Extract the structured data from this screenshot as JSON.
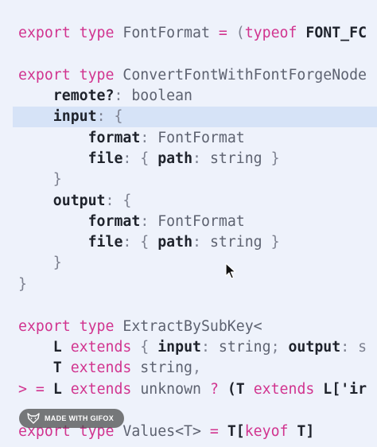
{
  "editor": {
    "highlighted_line_index": 3,
    "lines": [
      [
        {
          "t": "export type ",
          "c": "kw"
        },
        {
          "t": "FontFormat",
          "c": "tn"
        },
        {
          "t": " = ",
          "c": "kw"
        },
        {
          "t": "(",
          "c": "pn"
        },
        {
          "t": "typeof",
          "c": "kw"
        },
        {
          "t": " FONT_FC",
          "c": "id"
        }
      ],
      [
        {
          "t": "export type ",
          "c": "kw"
        },
        {
          "t": "ConvertFontWithFontForgeNode",
          "c": "tn"
        }
      ],
      [
        {
          "t": "    remote?",
          "c": "id"
        },
        {
          "t": ": ",
          "c": "pn"
        },
        {
          "t": "boolean",
          "c": "tp"
        }
      ],
      [
        {
          "t": "    input",
          "c": "id"
        },
        {
          "t": ": {",
          "c": "pn"
        }
      ],
      [
        {
          "t": "        format",
          "c": "id"
        },
        {
          "t": ": ",
          "c": "pn"
        },
        {
          "t": "FontFormat",
          "c": "tp"
        }
      ],
      [
        {
          "t": "        file",
          "c": "id"
        },
        {
          "t": ": { ",
          "c": "pn"
        },
        {
          "t": "path",
          "c": "id"
        },
        {
          "t": ": ",
          "c": "pn"
        },
        {
          "t": "string",
          "c": "tp"
        },
        {
          "t": " }",
          "c": "pn"
        }
      ],
      [
        {
          "t": "    }",
          "c": "pn"
        }
      ],
      [
        {
          "t": "    output",
          "c": "id"
        },
        {
          "t": ": {",
          "c": "pn"
        }
      ],
      [
        {
          "t": "        format",
          "c": "id"
        },
        {
          "t": ": ",
          "c": "pn"
        },
        {
          "t": "FontFormat",
          "c": "tp"
        }
      ],
      [
        {
          "t": "        file",
          "c": "id"
        },
        {
          "t": ": { ",
          "c": "pn"
        },
        {
          "t": "path",
          "c": "id"
        },
        {
          "t": ": ",
          "c": "pn"
        },
        {
          "t": "string",
          "c": "tp"
        },
        {
          "t": " }",
          "c": "pn"
        }
      ],
      [
        {
          "t": "    }",
          "c": "pn"
        }
      ],
      [
        {
          "t": "}",
          "c": "pn"
        }
      ],
      [
        {
          "t": "export type ",
          "c": "kw"
        },
        {
          "t": "ExtractBySubKey<",
          "c": "tn"
        }
      ],
      [
        {
          "t": "    L ",
          "c": "id"
        },
        {
          "t": "extends",
          "c": "kw"
        },
        {
          "t": " { ",
          "c": "pn"
        },
        {
          "t": "input",
          "c": "id"
        },
        {
          "t": ": ",
          "c": "pn"
        },
        {
          "t": "string",
          "c": "tp"
        },
        {
          "t": "; ",
          "c": "pn"
        },
        {
          "t": "output",
          "c": "id"
        },
        {
          "t": ": s",
          "c": "pn"
        }
      ],
      [
        {
          "t": "    T ",
          "c": "id"
        },
        {
          "t": "extends",
          "c": "kw"
        },
        {
          "t": " string",
          "c": "tp"
        },
        {
          "t": ",",
          "c": "pn"
        }
      ],
      [
        {
          "t": "> = ",
          "c": "kw"
        },
        {
          "t": "L ",
          "c": "id"
        },
        {
          "t": "extends",
          "c": "kw"
        },
        {
          "t": " unknown ",
          "c": "tp"
        },
        {
          "t": "? ",
          "c": "kw"
        },
        {
          "t": "(T ",
          "c": "id"
        },
        {
          "t": "extends",
          "c": "kw"
        },
        {
          "t": " L['ir",
          "c": "id"
        }
      ],
      [
        {
          "t": "export type ",
          "c": "kw"
        },
        {
          "t": "Values<T>",
          "c": "tn"
        },
        {
          "t": " = ",
          "c": "kw"
        },
        {
          "t": "T[",
          "c": "id"
        },
        {
          "t": "keyof",
          "c": "kw"
        },
        {
          "t": " T]",
          "c": "id"
        }
      ]
    ]
  },
  "badge": {
    "label": "MADE WITH GIFOX",
    "icon": "fox-icon"
  },
  "cursor": {
    "icon": "mouse-pointer-icon"
  }
}
